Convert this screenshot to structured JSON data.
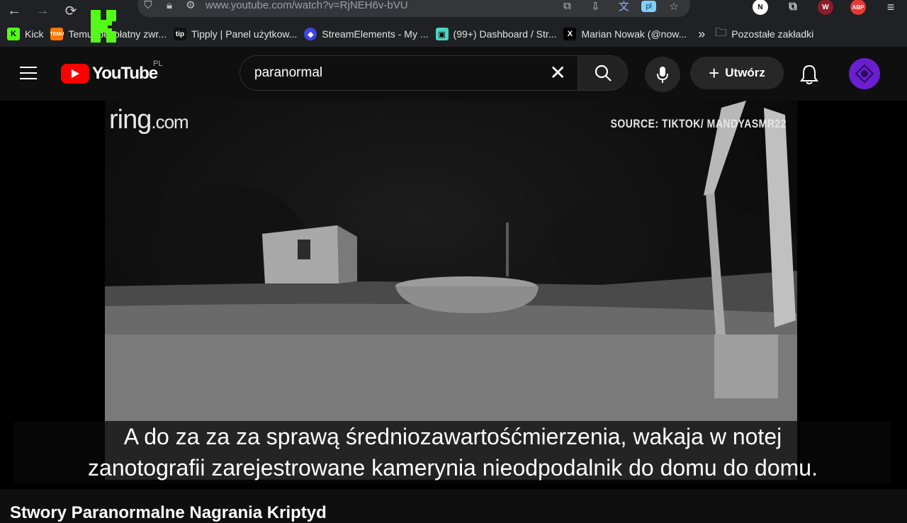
{
  "browser": {
    "url": "www.youtube.com/watch?v=RjNEH6v-bVU",
    "translate_badge": "pl",
    "extensions": [
      "N",
      "W",
      "ABP"
    ]
  },
  "bookmarks": [
    {
      "label": "Kick",
      "icon": "kick-icon",
      "color": "#53fc18"
    },
    {
      "label": "Temu: bezpłatny zwr...",
      "icon": "temu-icon",
      "color": "#fb7701"
    },
    {
      "label": "Tipply | Panel użytkow...",
      "icon": "tip-icon",
      "color": "#111111"
    },
    {
      "label": "StreamElements - My ...",
      "icon": "streamelements-icon",
      "color": "#3e46e0"
    },
    {
      "label": "(99+) Dashboard / Str...",
      "icon": "dashboard-icon",
      "color": "#4cd4c0"
    },
    {
      "label": "Marian Nowak (@now...",
      "icon": "x-icon",
      "color": "#000000"
    }
  ],
  "bookmarks_more": "»",
  "bookmarks_other": "Pozostałe zakładki",
  "youtube": {
    "logo_text": "YouTube",
    "region": "PL",
    "search_value": "paranormal",
    "create_label": "Utwórz"
  },
  "video": {
    "watermark": "ring",
    "watermark_suffix": ".com",
    "source_text": "SOURCE: TIKTOK/ MANDYASMR22",
    "caption_line1": "A do za za za sprawą średniozawartośćmierzenia, wakaja w notej",
    "caption_line2": "zanotografii zarejestrowane kamerynia nieodpodalnik do domu do domu."
  },
  "below_title": "Stwory Paranormalne Nagrania Kriptyd"
}
